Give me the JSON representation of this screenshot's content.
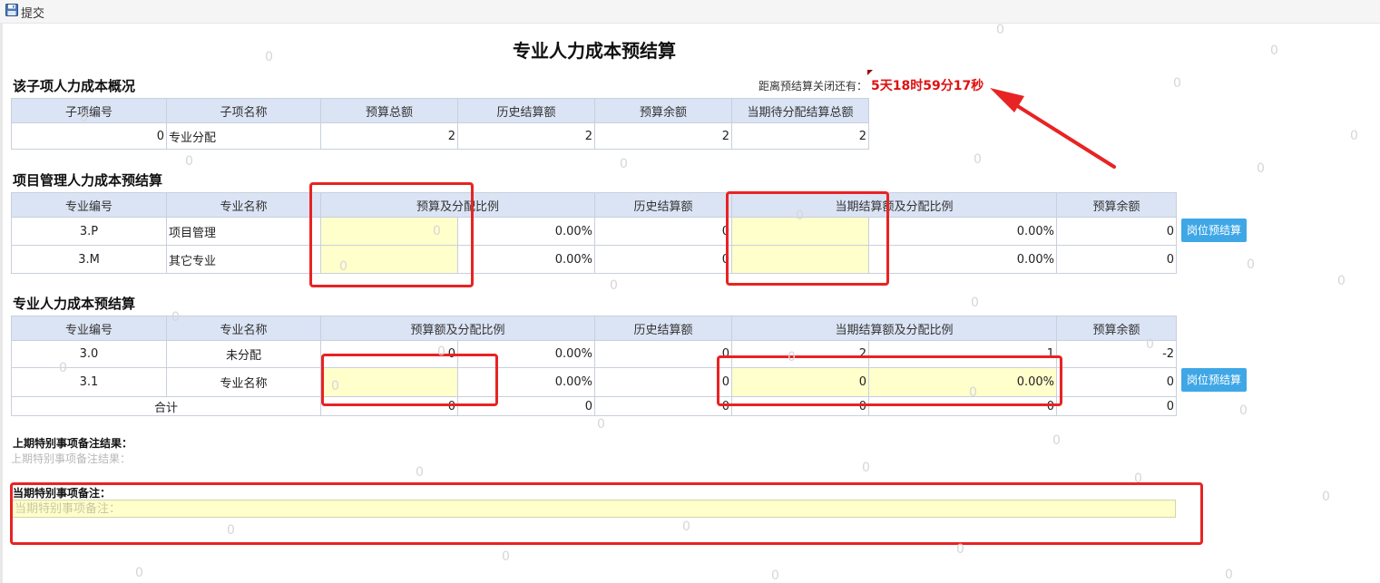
{
  "toolbar": {
    "submit_label": "提交"
  },
  "page_title": "专业人力成本预结算",
  "countdown": {
    "label": "距离预结算关闭还有：",
    "value": "5天18时59分17秒"
  },
  "overview": {
    "title": "该子项人力成本概况",
    "headers": [
      "子项编号",
      "子项名称",
      "预算总额",
      "历史结算额",
      "预算余额",
      "当期待分配结算总额"
    ],
    "row": [
      "0",
      "专业分配",
      "2",
      "2",
      "2",
      "2"
    ]
  },
  "mgmt": {
    "title": "项目管理人力成本预结算",
    "headers": [
      "专业编号",
      "专业名称",
      "预算及分配比例",
      "历史结算额",
      "当期结算额及分配比例",
      "预算余额"
    ],
    "rows": [
      {
        "code": "3.P",
        "name": "项目管理",
        "budget": "",
        "ratio": "0.00%",
        "history": "0",
        "current": "",
        "current_ratio": "0.00%",
        "remain": "0"
      },
      {
        "code": "3.M",
        "name": "其它专业",
        "budget": "",
        "ratio": "0.00%",
        "history": "0",
        "current": "",
        "current_ratio": "0.00%",
        "remain": "0"
      }
    ],
    "button": "岗位预结算"
  },
  "prof": {
    "title": "专业人力成本预结算",
    "headers": [
      "专业编号",
      "专业名称",
      "预算额及分配比例",
      "历史结算额",
      "当期结算额及分配比例",
      "预算余额"
    ],
    "rows": [
      {
        "code": "3.0",
        "name": "未分配",
        "budget": "0",
        "ratio": "0.00%",
        "history": "0",
        "current": "2",
        "current_ratio": "1",
        "remain": "-2"
      },
      {
        "code": "3.1",
        "name": "专业名称",
        "budget": "",
        "ratio": "0.00%",
        "history": "0",
        "current": "0",
        "current_ratio": "0.00%",
        "remain": "0"
      }
    ],
    "total": {
      "label": "合计",
      "budget": "0",
      "ratio": "0",
      "history": "0",
      "current": "0",
      "current_ratio": "0",
      "remain": "0"
    },
    "button": "岗位预结算"
  },
  "notes": {
    "prev_title": "上期特别事项备注结果：",
    "prev_placeholder": "上期特别事项备注结果：",
    "current_title": "当期特别事项备注：",
    "current_placeholder": "当期特别事项备注："
  },
  "watermark": "0",
  "colors": {
    "highlight": "#e82323",
    "countdown": "#e01010",
    "button": "#3fa7e6",
    "editable": "#ffffcc",
    "header_bg": "#dbe4f5"
  }
}
